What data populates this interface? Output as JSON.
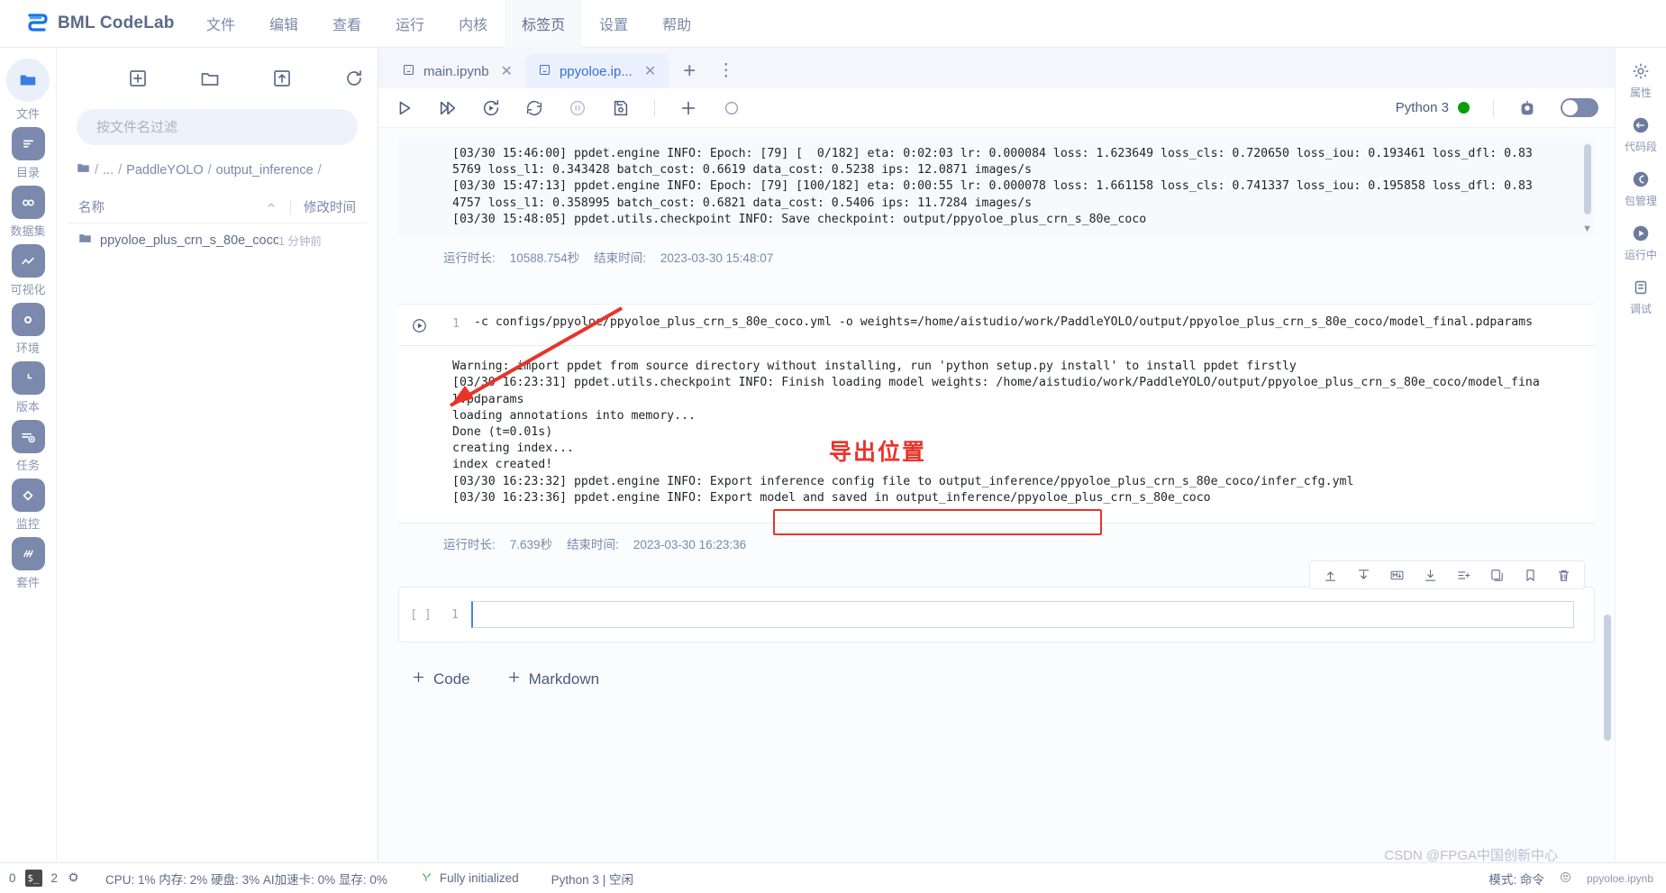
{
  "menubar": {
    "brand": "BML CodeLab",
    "brand_logo_icon": "bml-logo-icon",
    "items": [
      {
        "label": "文件",
        "active": false
      },
      {
        "label": "编辑",
        "active": false
      },
      {
        "label": "查看",
        "active": false
      },
      {
        "label": "运行",
        "active": false
      },
      {
        "label": "内核",
        "active": false
      },
      {
        "label": "标签页",
        "active": true
      },
      {
        "label": "设置",
        "active": false
      },
      {
        "label": "帮助",
        "active": false
      }
    ]
  },
  "left_rail": {
    "items": [
      {
        "label": "文件",
        "icon": "folder-icon",
        "active": true
      },
      {
        "label": "目录",
        "icon": "toc-icon",
        "active": false
      },
      {
        "label": "数据集",
        "icon": "dataset-icon",
        "active": false
      },
      {
        "label": "可视化",
        "icon": "chart-icon",
        "active": false
      },
      {
        "label": "环境",
        "icon": "environment-icon",
        "active": false
      },
      {
        "label": "版本",
        "icon": "version-icon",
        "active": false
      },
      {
        "label": "任务",
        "icon": "task-icon",
        "active": false
      },
      {
        "label": "监控",
        "icon": "monitor-icon",
        "active": false
      },
      {
        "label": "套件",
        "icon": "suite-icon",
        "active": false
      }
    ]
  },
  "file_panel": {
    "toolbar": [
      {
        "name": "new-file-button",
        "icon": "plus-box-icon"
      },
      {
        "name": "new-folder-button",
        "icon": "folder-outline-icon"
      },
      {
        "name": "upload-button",
        "icon": "upload-box-icon"
      },
      {
        "name": "refresh-button",
        "icon": "refresh-icon"
      }
    ],
    "search_placeholder": "按文件名过滤",
    "search_value": "",
    "breadcrumb": [
      "/",
      "...",
      "/",
      "PaddleYOLO",
      "/",
      "output_inference",
      "/"
    ],
    "columns": {
      "name": "名称",
      "modified": "修改时间"
    },
    "rows": [
      {
        "name": "ppyoloe_plus_crn_s_80e_coco",
        "modified": "1 分钟前",
        "icon": "folder-icon"
      }
    ]
  },
  "notebook": {
    "tabs": [
      {
        "label": "main.ipynb",
        "active": false,
        "icon": "notebook-icon"
      },
      {
        "label": "ppyoloe.ip...",
        "active": true,
        "icon": "notebook-icon"
      }
    ],
    "add_tab_label": "+",
    "more_tabs_label": "⋮",
    "toolbar": [
      {
        "name": "run-cell-button",
        "icon": "play-icon"
      },
      {
        "name": "run-all-button",
        "icon": "play-all-icon"
      },
      {
        "name": "restart-run-button",
        "icon": "restart-run-icon"
      },
      {
        "name": "restart-kernel-button",
        "icon": "restart-icon"
      },
      {
        "name": "interrupt-button",
        "icon": "pause-icon"
      },
      {
        "name": "save-button",
        "icon": "save-icon"
      },
      {
        "name": "insert-cell-button",
        "icon": "plus-icon"
      },
      {
        "name": "stop-button",
        "icon": "circle-icon"
      }
    ],
    "kernel_name": "Python 3",
    "kernel_status_color": "#0a9e0a",
    "kernel_extra_icon": "robot-icon",
    "toggle_state": "off"
  },
  "cells": {
    "output_1": [
      "[03/30 15:46:00] ppdet.engine INFO: Epoch: [79] [  0/182] eta: 0:02:03 lr: 0.000084 loss: 1.623649 loss_cls: 0.720650 loss_iou: 0.193461 loss_dfl: 0.83",
      "5769 loss_l1: 0.343428 batch_cost: 0.6619 data_cost: 0.5238 ips: 12.0871 images/s",
      "[03/30 15:47:13] ppdet.engine INFO: Epoch: [79] [100/182] eta: 0:00:55 lr: 0.000078 loss: 1.661158 loss_cls: 0.741337 loss_iou: 0.195858 loss_dfl: 0.83",
      "4757 loss_l1: 0.358995 batch_cost: 0.6821 data_cost: 0.5406 ips: 11.7284 images/s",
      "[03/30 15:48:05] ppdet.utils.checkpoint INFO: Save checkpoint: output/ppyoloe_plus_crn_s_80e_coco"
    ],
    "meta_1": {
      "duration_label": "运行时长:",
      "duration_value": "10588.754秒",
      "end_label": "结束时间:",
      "end_value": "2023-03-30 15:48:07"
    },
    "input_2": {
      "number": "1",
      "code": "-c configs/ppyoloe/ppyoloe_plus_crn_s_80e_coco.yml -o weights=/home/aistudio/work/PaddleYOLO/output/ppyoloe_plus_crn_s_80e_coco/model_final.pdparams",
      "run_icon": "play-circle-icon"
    },
    "output_2": [
      "Warning: import ppdet from source directory without installing, run 'python setup.py install' to install ppdet firstly",
      "[03/30 16:23:31] ppdet.utils.checkpoint INFO: Finish loading model weights: /home/aistudio/work/PaddleYOLO/output/ppyoloe_plus_crn_s_80e_coco/model_fina",
      "l.pdparams",
      "loading annotations into memory...",
      "Done (t=0.01s)",
      "creating index...",
      "index created!",
      "[03/30 16:23:32] ppdet.engine INFO: Export inference config file to output_inference/ppyoloe_plus_crn_s_80e_coco/infer_cfg.yml",
      "[03/30 16:23:36] ppdet.engine INFO: Export model and saved in output_inference/ppyoloe_plus_crn_s_80e_coco"
    ],
    "meta_2": {
      "duration_label": "运行时长:",
      "duration_value": "7.639秒",
      "end_label": "结束时间:",
      "end_value": "2023-03-30 16:23:36"
    },
    "empty_cell": {
      "prompt": "[ ]",
      "number": "1",
      "value": ""
    },
    "cell_tools": [
      {
        "name": "move-up-button",
        "icon": "move-up-icon"
      },
      {
        "name": "move-down-button",
        "icon": "move-down-icon"
      },
      {
        "name": "markdown-button",
        "icon": "markdown-icon"
      },
      {
        "name": "duplicate-button",
        "icon": "duplicate-icon"
      },
      {
        "name": "insert-above-button",
        "icon": "insert-above-icon"
      },
      {
        "name": "copy-button",
        "icon": "copy-icon"
      },
      {
        "name": "bookmark-button",
        "icon": "bookmark-icon"
      },
      {
        "name": "delete-button",
        "icon": "trash-icon"
      }
    ],
    "add_buttons": [
      {
        "label": "Code",
        "icon": "plus-icon"
      },
      {
        "label": "Markdown",
        "icon": "plus-icon"
      }
    ]
  },
  "annotations": {
    "export_location_text": "导出位置",
    "highlight_color": "#e8342a",
    "highlighted_path": "output_inference/ppyoloe_plus_crn_s_80e_coco"
  },
  "right_rail": {
    "items": [
      {
        "label": "属性",
        "icon": "properties-icon"
      },
      {
        "label": "代码段",
        "icon": "snippet-icon"
      },
      {
        "label": "包管理",
        "icon": "package-icon"
      },
      {
        "label": "运行中",
        "icon": "running-icon"
      },
      {
        "label": "调试",
        "icon": "debug-icon"
      }
    ]
  },
  "statusbar": {
    "terminal_count": "0",
    "terminal_icon": "terminal-icon",
    "kernel_count": "2",
    "cpu_chip_icon": "chip-icon",
    "metrics": "CPU: 1%  内存: 2%  硬盘: 3%  AI加速卡: 0%  显存: 0%",
    "init_icon": "init-icon",
    "init_text": "Fully initialized",
    "kernel_text": "Python 3 | 空闲",
    "mode_text": "模式: 命令",
    "file_text": "ppyoloe.ipynb",
    "watermark": "CSDN @FPGA中国创新中心"
  }
}
